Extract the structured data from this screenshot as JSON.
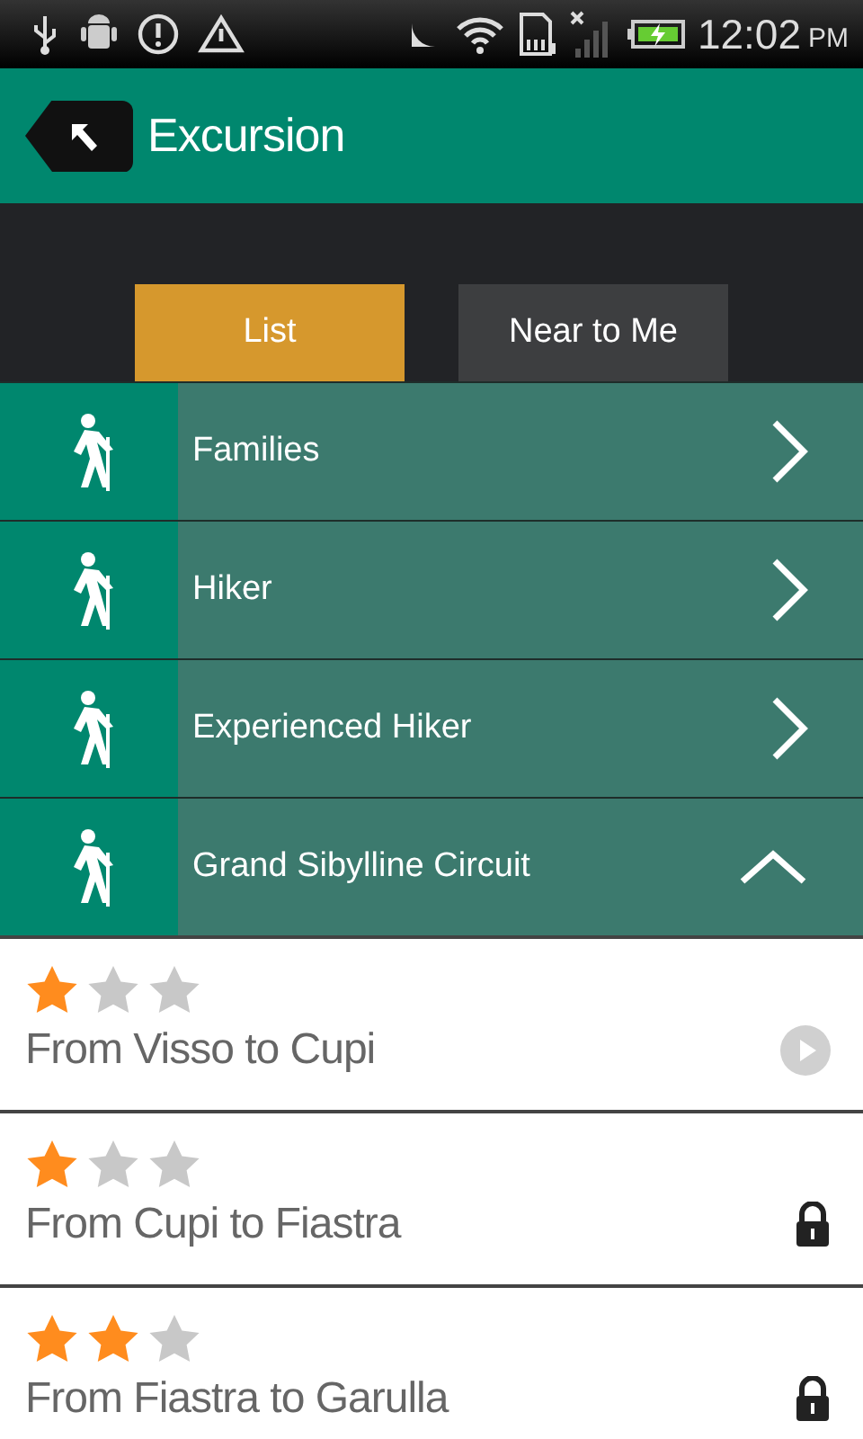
{
  "status_bar": {
    "time": "12:02",
    "ampm": "PM"
  },
  "header": {
    "title": "Excursion"
  },
  "tabs": [
    {
      "label": "List",
      "selected": true
    },
    {
      "label": "Near to Me",
      "selected": false
    }
  ],
  "categories": [
    {
      "label": "Families",
      "expanded": false
    },
    {
      "label": "Hiker",
      "expanded": false
    },
    {
      "label": "Experienced Hiker",
      "expanded": false
    },
    {
      "label": "Grand Sibylline Circuit",
      "expanded": true
    }
  ],
  "routes": [
    {
      "title": "From Visso to Cupi",
      "stars": 1,
      "kind": "play"
    },
    {
      "title": "From Cupi to Fiastra",
      "stars": 1,
      "kind": "locked"
    },
    {
      "title": "From Fiastra to Garulla",
      "stars": 2,
      "kind": "locked"
    }
  ]
}
